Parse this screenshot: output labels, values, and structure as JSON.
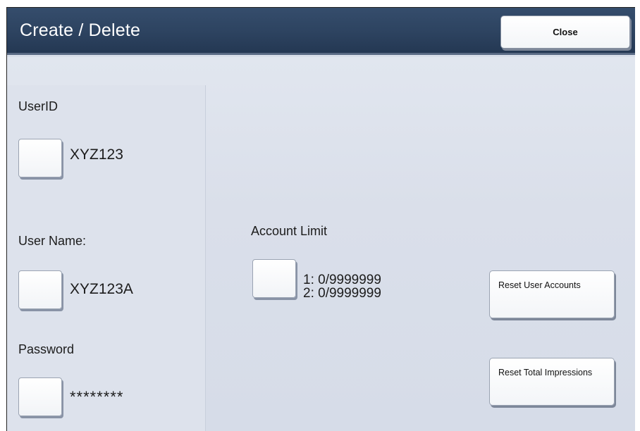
{
  "header": {
    "title": "Create / Delete",
    "close_label": "Close"
  },
  "user_id": {
    "label": "UserID",
    "value": "XYZ123"
  },
  "user_name": {
    "label": "User Name:",
    "value": "XYZ123A"
  },
  "password": {
    "label": "Password",
    "value": "********"
  },
  "account_limit": {
    "label": "Account Limit",
    "line1": "1: 0/9999999",
    "line2": "2: 0/9999999"
  },
  "actions": {
    "reset_user_accounts": "Reset User Accounts",
    "reset_total_impressions": "Reset Total Impressions"
  }
}
